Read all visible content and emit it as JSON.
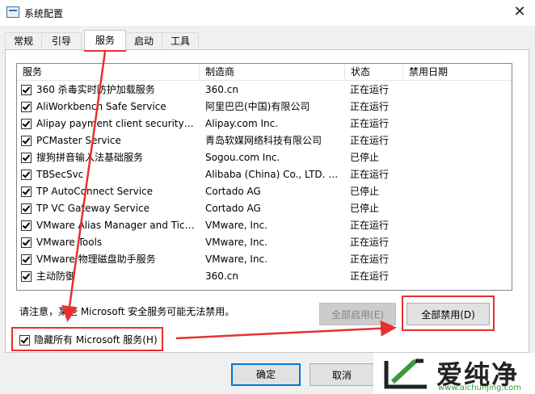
{
  "window": {
    "title": "系统配置",
    "close_glyph": "✕"
  },
  "tabs": [
    {
      "label": "常规"
    },
    {
      "label": "引导"
    },
    {
      "label": "服务"
    },
    {
      "label": "启动"
    },
    {
      "label": "工具"
    }
  ],
  "list": {
    "columns": [
      "服务",
      "制造商",
      "状态",
      "禁用日期"
    ],
    "rows": [
      {
        "service": "360 杀毒实时防护加载服务",
        "vendor": "360.cn",
        "status": "正在运行",
        "checked": true
      },
      {
        "service": "AliWorkbench Safe Service",
        "vendor": "阿里巴巴(中国)有限公司",
        "status": "正在运行",
        "checked": true
      },
      {
        "service": "Alipay payment client security ser...",
        "vendor": "Alipay.com Inc.",
        "status": "正在运行",
        "checked": true
      },
      {
        "service": "PCMaster Service",
        "vendor": "青岛软媒网络科技有限公司",
        "status": "正在运行",
        "checked": true
      },
      {
        "service": "搜狗拼音输入法基础服务",
        "vendor": "Sogou.com Inc.",
        "status": "已停止",
        "checked": true
      },
      {
        "service": "TBSecSvc",
        "vendor": "Alibaba (China) Co., LTD. A...",
        "status": "正在运行",
        "checked": true
      },
      {
        "service": "TP AutoConnect Service",
        "vendor": "Cortado AG",
        "status": "已停止",
        "checked": true
      },
      {
        "service": "TP VC Gateway Service",
        "vendor": "Cortado AG",
        "status": "已停止",
        "checked": true
      },
      {
        "service": "VMware Alias Manager and Tick...",
        "vendor": "VMware, Inc.",
        "status": "正在运行",
        "checked": true
      },
      {
        "service": "VMware Tools",
        "vendor": "VMware, Inc.",
        "status": "正在运行",
        "checked": true
      },
      {
        "service": "VMware 物理磁盘助手服务",
        "vendor": "VMware, Inc.",
        "status": "正在运行",
        "checked": true
      },
      {
        "service": "主动防御",
        "vendor": "360.cn",
        "status": "正在运行",
        "checked": true
      }
    ]
  },
  "note": "请注意，某些 Microsoft 安全服务可能无法禁用。",
  "buttons": {
    "enable_all": "全部启用(E)",
    "disable_all": "全部禁用(D)",
    "ok": "确定",
    "cancel": "取消"
  },
  "hide_ms": {
    "label": "隐藏所有 Microsoft 服务(H)",
    "checked": true
  },
  "watermark": {
    "name": "爱纯净",
    "url": "www.aichunjing.com"
  },
  "colors": {
    "annotation_red": "#e83030",
    "ok_border": "#0078d7",
    "watermark_green": "#3a9a3a"
  }
}
